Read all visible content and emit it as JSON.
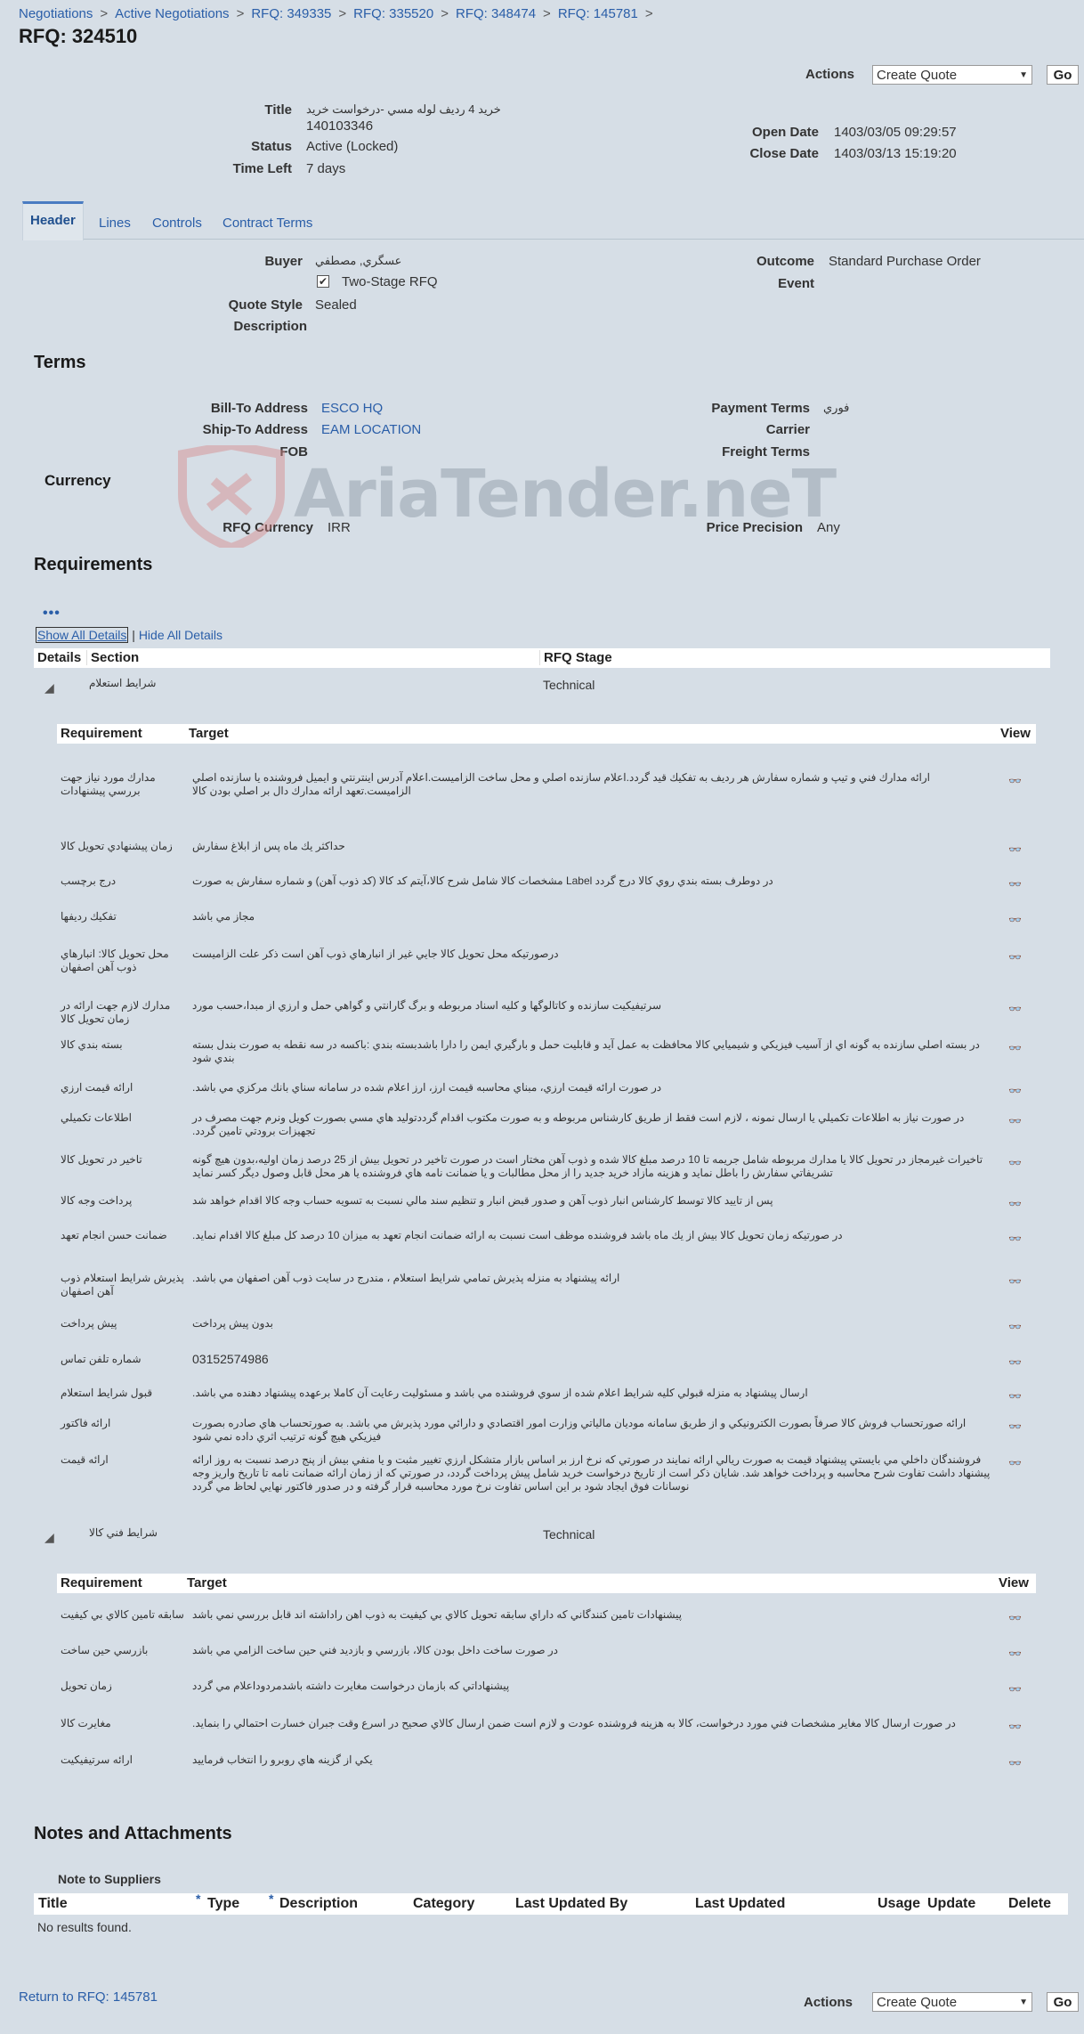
{
  "breadcrumb": [
    "Negotiations",
    "Active Negotiations",
    "RFQ: 349335",
    "RFQ: 335520",
    "RFQ: 348474",
    "RFQ: 145781"
  ],
  "page_title": "RFQ: 324510",
  "actions": {
    "label": "Actions",
    "select_value": "Create Quote",
    "go": "Go"
  },
  "summary": {
    "title_label": "Title",
    "title_value": "خريد 4 رديف لوله مسي -درخواست خريد",
    "title_value2": "140103346",
    "status_label": "Status",
    "status_value": "Active (Locked)",
    "timeleft_label": "Time Left",
    "timeleft_value": "7 days",
    "open_label": "Open Date",
    "open_value": "1403/03/05 09:29:57",
    "close_label": "Close Date",
    "close_value": "1403/03/13 15:19:20"
  },
  "tabs": [
    "Header",
    "Lines",
    "Controls",
    "Contract Terms"
  ],
  "header": {
    "buyer_label": "Buyer",
    "buyer_value": "عسگري, مصطفي",
    "twostage_label": "Two-Stage RFQ",
    "quotestyle_label": "Quote Style",
    "quotestyle_value": "Sealed",
    "description_label": "Description",
    "outcome_label": "Outcome",
    "outcome_value": "Standard Purchase Order",
    "event_label": "Event"
  },
  "terms": {
    "title": "Terms",
    "billto_label": "Bill-To Address",
    "billto_value": "ESCO HQ",
    "shipto_label": "Ship-To Address",
    "shipto_value": "EAM LOCATION",
    "fob_label": "FOB",
    "payment_label": "Payment Terms",
    "payment_value": "فوري",
    "carrier_label": "Carrier",
    "freight_label": "Freight Terms"
  },
  "currency": {
    "title": "Currency",
    "rfq_label": "RFQ Currency",
    "rfq_value": "IRR",
    "precision_label": "Price Precision",
    "precision_value": "Any"
  },
  "watermark": "AriaTender.neT",
  "requirements": {
    "title": "Requirements",
    "show_all": "Show All Details",
    "pipe": "|",
    "hide_all": "Hide All Details",
    "cols": {
      "details": "Details",
      "section": "Section",
      "stage": "RFQ Stage"
    },
    "sub_cols": {
      "req": "Requirement",
      "target": "Target",
      "view": "View"
    },
    "view_icon": "👓",
    "sections": [
      {
        "name": "شرايط استعلام",
        "stage": "Technical",
        "rows": [
          {
            "name": "مدارك مورد نياز جهت بررسي پيشنهادات",
            "target": "ارائه مدارك فني و تيپ و شماره سفارش هر رديف به تفكيك قيد گردد.اعلام سازنده اصلي و محل ساخت الزاميست.اعلام آدرس اينترنتي و ايميل فروشنده يا سازنده اصلي الزاميست.تعهد ارائه مدارك دال بر اصلي بودن كالا"
          },
          {
            "name": "زمان پيشنهادي تحويل كالا",
            "target": "حداكثر يك ماه پس از ابلاغ سفارش"
          },
          {
            "name": "درج برچسب",
            "target": "در دوطرف بسته بندي روي كالا درج گردد Label مشخصات كالا شامل شرح كالا،آيتم كد كالا (كد ذوب آهن) و شماره سفارش به صورت"
          },
          {
            "name": "تفكيك رديفها",
            "target": "مجاز مي باشد"
          },
          {
            "name": "محل تحويل كالا: انبارهاي ذوب آهن اصفهان",
            "target": "درصورتيكه محل تحويل كالا جايي غير از انبارهاي ذوب آهن است ذكر علت الزاميست"
          },
          {
            "name": "مدارك لازم جهت ارائه در زمان تحويل كالا",
            "target": "سرتيفيكيت سازنده و كاتالوگها و كليه اسناد مربوطه و برگ گارانتي و گواهي حمل و ارزي از مبدا،حسب مورد"
          },
          {
            "name": "بسته بندي كالا",
            "target": "در بسته اصلي سازنده به گونه اي از آسيب فيزيكي و شيميايي كالا محافظت به عمل آيد و قابليت حمل و بارگيري ايمن را دارا باشدبسته بندي :باكسه در سه نقطه به صورت بندل بسته بندي شود"
          },
          {
            "name": "ارائه قيمت ارزي",
            "target": "در صورت ارائه قيمت ارزي، مبناي محاسبه قيمت ارز، ارز اعلام شده در سامانه سناي بانك مركزي مي باشد."
          },
          {
            "name": "اطلاعات تكميلي",
            "target": "در صورت نياز به اطلاعات تكميلي يا ارسال نمونه ، لازم است فقط از طريق كارشناس مربوطه و به صورت مكتوب اقدام گرددتوليد هاي مسي بصورت كويل ونرم جهت مصرف در تجهيزات برودتي تامين گردد."
          },
          {
            "name": "تاخير در تحويل كالا",
            "target": "تاخيرات غيرمجاز در تحويل كالا يا مدارك مربوطه شامل جريمه تا 10 درصد مبلغ كالا شده و ذوب آهن مختار است در صورت تاخير در تحويل بيش از 25 درصد زمان اوليه،بدون هيچ گونه تشريفاتي سفارش را باطل نمايد و هزينه مازاد خريد جديد را از محل مطالبات و يا ضمانت نامه هاي فروشنده يا هر محل قابل وصول ديگر كسر نمايد"
          },
          {
            "name": "پرداخت وجه كالا",
            "target": "پس از تاييد كالا توسط كارشناس انبار ذوب آهن و صدور قبض انبار و تنظيم سند مالي نسبت به تسويه حساب وجه كالا اقدام خواهد شد"
          },
          {
            "name": "ضمانت حسن انجام تعهد",
            "target": "در صورتيكه زمان تحويل كالا بيش از يك ماه باشد فروشنده موظف است نسبت به ارائه ضمانت انجام تعهد به ميزان 10 درصد كل مبلغ كالا اقدام نمايد."
          },
          {
            "name": "پذيرش شرايط استعلام ذوب آهن اصفهان",
            "target": "ارائه پيشنهاد به منزله پذيرش تمامي شرايط استعلام ، مندرج در سايت ذوب آهن اصفهان مي باشد."
          },
          {
            "name": "پيش پرداخت",
            "target": "بدون پيش پرداخت"
          },
          {
            "name": "شماره تلفن تماس",
            "target": "03152574986"
          },
          {
            "name": "قبول شرايط استعلام",
            "target": "ارسال پيشنهاد به منزله قبولي كليه شرايط اعلام شده از سوي فروشنده مي باشد و مسئوليت رعايت آن كاملا برعهده پيشنهاد دهنده مي باشد."
          },
          {
            "name": "ارائه فاكتور",
            "target": "ارائه صورتحساب فروش كالا صرفاً بصورت الكترونيكي و از طريق سامانه موديان مالياتي وزارت امور اقتصادي و دارائي مورد پذيرش مي باشد. به صورتحساب هاي صادره بصورت فيزيكي هيچ گونه ترتيب اثري داده نمي شود"
          },
          {
            "name": "ارائه قيمت",
            "target": "فروشندگان داخلي مي بايستي پيشنهاد قيمت به صورت ريالي ارائه نمايند در صورتي كه نرخ ارز بر اساس بازار متشكل ارزي تغيير مثبت و يا منفي بيش از پنج درصد نسبت به روز ارائه پيشنهاد داشت تفاوت شرح محاسبه و پرداخت خواهد شد. شايان ذكر است از تاريخ درخواست خريد شامل پيش پرداخت گردد، در صورتي كه از زمان ارائه ضمانت نامه تا تاريخ واريز وجه نوسانات فوق ايجاد شود بر اين اساس تفاوت نرخ مورد محاسبه قرار گرفته و در صدور فاكتور نهايي لحاظ مي گردد"
          }
        ]
      },
      {
        "name": "شرايط فني كالا",
        "stage": "Technical",
        "rows": [
          {
            "name": "سابقه تامين كالاي بي كيفيت",
            "target": "پيشنهادات تامين كنندگاني كه داراي سابقه تحويل كالاي بي كيفيت به ذوب اهن راداشته اند قابل بررسي نمي باشد"
          },
          {
            "name": "بازرسي حين ساخت",
            "target": "در صورت ساخت داخل بودن كالا، بازرسي و بازديد فني حين ساخت الزامي مي باشد"
          },
          {
            "name": "زمان تحويل",
            "target": "پيشنهاداتي كه بازمان درخواست مغايرت داشته باشدمردوداعلام مي گردد"
          },
          {
            "name": "مغايرت كالا",
            "target": "در صورت ارسال كالا مغاير مشخصات فني مورد درخواست، كالا به هزينه فروشنده عودت و لازم است ضمن ارسال كالاي صحيح در اسرع وقت جبران خسارت احتمالي را بنمايد."
          },
          {
            "name": "ارائه سرتيفيكيت",
            "target": "يكي از گزينه هاي روبرو را انتخاب فرماييد"
          }
        ]
      }
    ]
  },
  "notes": {
    "title": "Notes and Attachments",
    "note_to_suppliers": "Note to Suppliers",
    "cols": [
      "Title",
      "Type",
      "Description",
      "Category",
      "Last Updated By",
      "Last Updated",
      "Usage",
      "Update",
      "Delete"
    ],
    "required_mark": "*",
    "empty": "No results found."
  },
  "footer": {
    "return_link": "Return to RFQ: 145781"
  },
  "colors": {
    "background": "#d6dee6",
    "link": "#2a5ea8"
  }
}
